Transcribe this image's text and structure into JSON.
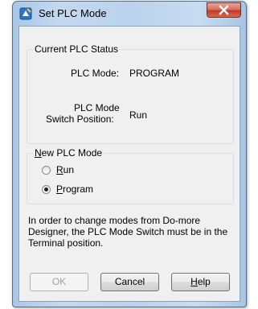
{
  "dialog": {
    "title": "Set PLC Mode",
    "icons": {
      "app": "plc-app-icon",
      "close": "close-icon"
    }
  },
  "current_status": {
    "legend": "Current PLC Status",
    "mode_label": "PLC Mode:",
    "mode_value": "PROGRAM",
    "switch_label_line1": "PLC Mode",
    "switch_label_line2": "Switch Position:",
    "switch_value": "Run"
  },
  "new_mode": {
    "legend_hotkey": "N",
    "legend_rest": "ew PLC Mode",
    "options": [
      {
        "hotkey": "R",
        "rest": "un",
        "selected": false
      },
      {
        "hotkey": "P",
        "rest": "rogram",
        "selected": true
      }
    ]
  },
  "info_text": "In order to change modes from Do-more Designer, the PLC Mode Switch must be in the Terminal position.",
  "buttons": {
    "ok": "OK",
    "cancel": "Cancel",
    "help_hotkey": "H",
    "help_rest": "elp"
  },
  "colors": {
    "frame": "#bad2ec",
    "close_button": "#c0392b",
    "client_bg": "#f0f0f0"
  }
}
